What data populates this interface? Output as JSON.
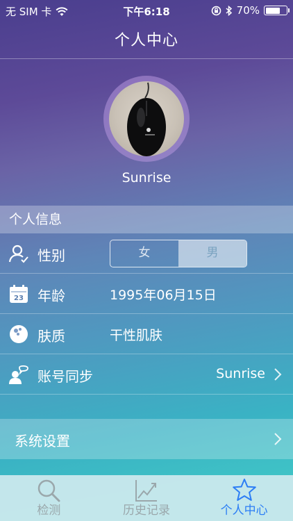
{
  "status_bar": {
    "carrier": "无 SIM 卡",
    "time": "下午6:18",
    "battery": "70%",
    "battery_level": 0.7
  },
  "nav": {
    "title": "个人中心"
  },
  "profile": {
    "username": "Sunrise"
  },
  "section": {
    "title": "个人信息"
  },
  "rows": {
    "gender": {
      "label": "性别",
      "options": [
        "女",
        "男"
      ],
      "selected": "男"
    },
    "age": {
      "label": "年龄",
      "value": "1995年06月15日",
      "calendar_day": "23"
    },
    "skin": {
      "label": "肤质",
      "value": "干性肌肤"
    },
    "sync": {
      "label": "账号同步",
      "value": "Sunrise"
    }
  },
  "settings": {
    "label": "系统设置"
  },
  "tabs": [
    {
      "label": "检测",
      "icon": "search-icon",
      "active": false
    },
    {
      "label": "历史记录",
      "icon": "chart-icon",
      "active": false
    },
    {
      "label": "个人中心",
      "icon": "star-icon",
      "active": true
    }
  ],
  "colors": {
    "accent": "#2b7df5",
    "tab_inactive": "#9aa7ab",
    "segment_selected_text": "#7aa3c0"
  }
}
